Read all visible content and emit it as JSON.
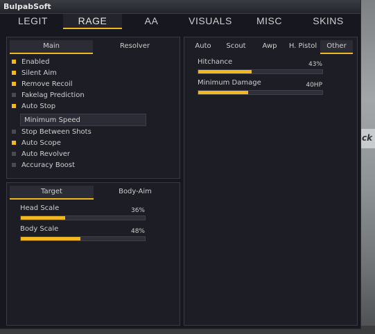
{
  "window": {
    "title": "BulpabSoft"
  },
  "tabs": [
    {
      "label": "LEGIT",
      "active": false
    },
    {
      "label": "RAGE",
      "active": true
    },
    {
      "label": "AA",
      "active": false
    },
    {
      "label": "VISUALS",
      "active": false
    },
    {
      "label": "MISC",
      "active": false
    },
    {
      "label": "SKINS",
      "active": false
    }
  ],
  "main_panel": {
    "subtabs": [
      "Main",
      "Resolver"
    ],
    "active_subtab": "Main",
    "options": [
      {
        "label": "Enabled",
        "checked": true
      },
      {
        "label": "Silent Aim",
        "checked": true
      },
      {
        "label": "Remove Recoil",
        "checked": true
      },
      {
        "label": "Fakelag Prediction",
        "checked": false
      },
      {
        "label": "Auto Stop",
        "checked": true
      }
    ],
    "auto_stop_mode": "Minimum Speed",
    "options_after": [
      {
        "label": "Stop Between Shots",
        "checked": false
      },
      {
        "label": "Auto Scope",
        "checked": true
      },
      {
        "label": "Auto Revolver",
        "checked": false
      },
      {
        "label": "Accuracy Boost",
        "checked": false
      }
    ]
  },
  "target_panel": {
    "subtabs": [
      "Target",
      "Body-Aim"
    ],
    "active_subtab": "Target",
    "sliders": [
      {
        "label": "Head Scale",
        "value_text": "36%",
        "value": 36
      },
      {
        "label": "Body Scale",
        "value_text": "48%",
        "value": 48
      }
    ]
  },
  "weapon_panel": {
    "subtabs": [
      "Auto",
      "Scout",
      "Awp",
      "H. Pistol",
      "Other"
    ],
    "active_subtab": "Other",
    "sliders": [
      {
        "label": "Hitchance",
        "value_text": "43%",
        "value": 43
      },
      {
        "label": "Minimum Damage",
        "value_text": "40HP",
        "value": 40
      }
    ]
  },
  "background": {
    "sign_text": "ck"
  },
  "colors": {
    "accent": "#f2b824",
    "panel": "#1c1d25",
    "window": "#17181f"
  }
}
